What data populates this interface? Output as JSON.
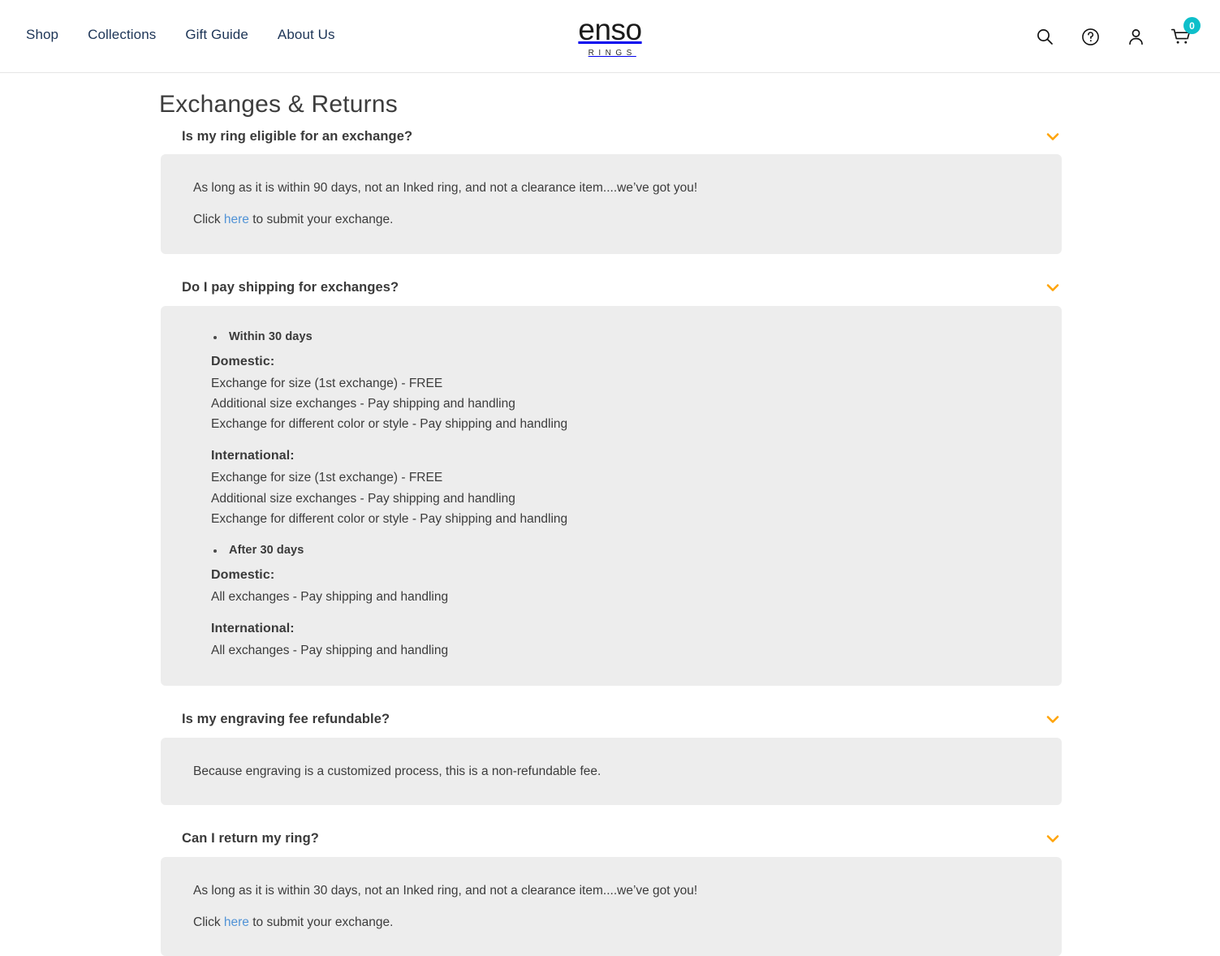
{
  "header": {
    "nav": [
      {
        "label": "Shop"
      },
      {
        "label": "Collections"
      },
      {
        "label": "Gift Guide"
      },
      {
        "label": "About Us"
      }
    ],
    "logo": {
      "word": "enso",
      "sub": "RINGS"
    },
    "actions": {
      "search_icon": "search-icon",
      "help_icon": "question-mark-circle-icon",
      "account_icon": "person-icon",
      "cart_icon": "shopping-cart-icon",
      "cart_count": "0",
      "badge_color": "#0ebfca"
    }
  },
  "page": {
    "title": "Exchanges & Returns",
    "accent_chevron_color": "#ffa40a",
    "panel_bg": "#ededed",
    "link_color": "#5193d6"
  },
  "faqs": [
    {
      "question": "Is my ring eligible for an exchange?",
      "chevron": "chevron-down-icon",
      "body": {
        "line1": "As long as it is within 90 days, not an Inked ring, and not a clearance item....we’ve got you!",
        "line2_before": "Click ",
        "line2_link": "here",
        "line2_after": " to submit your exchange."
      }
    },
    {
      "question": "Do I pay shipping for exchanges?",
      "chevron": "chevron-down-icon",
      "shipping": [
        {
          "period": "Within 30 days",
          "blocks": [
            {
              "region": "Domestic:",
              "lines": [
                "Exchange for size (1st exchange) - FREE",
                "Additional size exchanges - Pay shipping and handling",
                "Exchange for different color or style - Pay shipping and handling"
              ]
            },
            {
              "region": "International:",
              "lines": [
                "Exchange for size (1st exchange) - FREE",
                "Additional size exchanges - Pay shipping and handling",
                "Exchange for different color or style - Pay shipping and handling"
              ]
            }
          ]
        },
        {
          "period": "After 30 days",
          "blocks": [
            {
              "region": "Domestic:",
              "lines": [
                "All exchanges - Pay shipping and handling"
              ]
            },
            {
              "region": "International:",
              "lines": [
                "All exchanges - Pay shipping and handling"
              ]
            }
          ]
        }
      ]
    },
    {
      "question": "Is my engraving fee refundable?",
      "chevron": "chevron-down-icon",
      "body": {
        "line1": "Because engraving is a customized process, this is a non-refundable fee."
      }
    },
    {
      "question": "Can I return my ring?",
      "chevron": "chevron-down-icon",
      "body": {
        "line1": "As long as it is within 30 days, not an Inked ring, and not a clearance item....we’ve got you!",
        "line2_before": "Click ",
        "line2_link": "here",
        "line2_after": " to submit your exchange."
      }
    }
  ]
}
